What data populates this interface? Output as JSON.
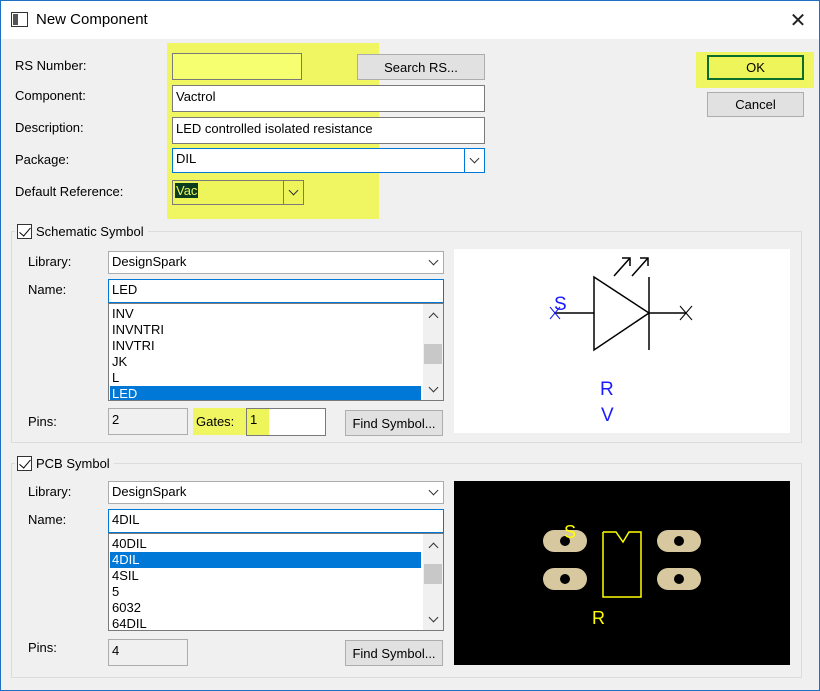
{
  "window": {
    "title": "New Component",
    "close_glyph": "✕"
  },
  "form": {
    "rs_number_label": "RS Number:",
    "rs_number_value": "",
    "search_rs_label": "Search RS...",
    "component_label": "Component:",
    "component_value": "Vactrol",
    "description_label": "Description:",
    "description_value": "LED controlled isolated resistance",
    "package_label": "Package:",
    "package_value": "DIL",
    "default_reference_label": "Default Reference:",
    "default_reference_value": "Vac"
  },
  "buttons": {
    "ok_label": "OK",
    "cancel_label": "Cancel"
  },
  "schematic": {
    "group_label": "Schematic Symbol",
    "checked": true,
    "library_label": "Library:",
    "library_value": "DesignSpark",
    "name_label": "Name:",
    "name_value": "LED",
    "list_items": [
      "INV",
      "INVNTRI",
      "INVTRI",
      "JK",
      "L",
      "LED"
    ],
    "selected_item": "LED",
    "pins_label": "Pins:",
    "pins_value": "2",
    "gates_label": "Gates:",
    "gates_value": "1",
    "find_symbol_label": "Find Symbol...",
    "preview": {
      "pin_label": "S",
      "ref_label": "R",
      "value_label": "V"
    }
  },
  "pcb": {
    "group_label": "PCB Symbol",
    "checked": true,
    "library_label": "Library:",
    "library_value": "DesignSpark",
    "name_label": "Name:",
    "name_value": "4DIL",
    "list_items": [
      "40DIL",
      "4DIL",
      "4SIL",
      "5",
      "6032",
      "64DIL"
    ],
    "selected_item": "4DIL",
    "pins_label": "Pins:",
    "pins_value": "4",
    "find_symbol_label": "Find Symbol...",
    "preview": {
      "pin_label": "S",
      "ref_label": "R"
    }
  },
  "colors": {
    "highlight": "#eef55a",
    "selection": "#0078d7",
    "schematic_text": "#1a1aff",
    "pcb_text": "#ffff00",
    "pcb_pad": "#d8c8a0"
  }
}
